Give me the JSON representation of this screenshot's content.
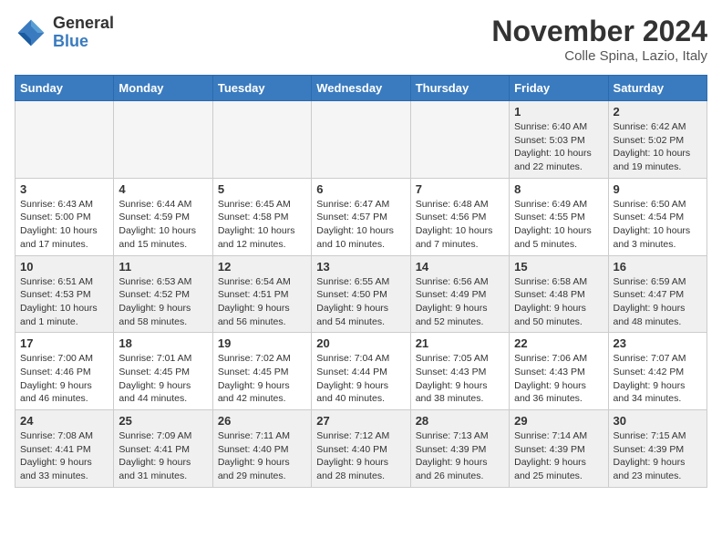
{
  "logo": {
    "general": "General",
    "blue": "Blue"
  },
  "title": "November 2024",
  "location": "Colle Spina, Lazio, Italy",
  "days_of_week": [
    "Sunday",
    "Monday",
    "Tuesday",
    "Wednesday",
    "Thursday",
    "Friday",
    "Saturday"
  ],
  "weeks": [
    [
      {
        "day": "",
        "info": ""
      },
      {
        "day": "",
        "info": ""
      },
      {
        "day": "",
        "info": ""
      },
      {
        "day": "",
        "info": ""
      },
      {
        "day": "",
        "info": ""
      },
      {
        "day": "1",
        "info": "Sunrise: 6:40 AM\nSunset: 5:03 PM\nDaylight: 10 hours\nand 22 minutes."
      },
      {
        "day": "2",
        "info": "Sunrise: 6:42 AM\nSunset: 5:02 PM\nDaylight: 10 hours\nand 19 minutes."
      }
    ],
    [
      {
        "day": "3",
        "info": "Sunrise: 6:43 AM\nSunset: 5:00 PM\nDaylight: 10 hours\nand 17 minutes."
      },
      {
        "day": "4",
        "info": "Sunrise: 6:44 AM\nSunset: 4:59 PM\nDaylight: 10 hours\nand 15 minutes."
      },
      {
        "day": "5",
        "info": "Sunrise: 6:45 AM\nSunset: 4:58 PM\nDaylight: 10 hours\nand 12 minutes."
      },
      {
        "day": "6",
        "info": "Sunrise: 6:47 AM\nSunset: 4:57 PM\nDaylight: 10 hours\nand 10 minutes."
      },
      {
        "day": "7",
        "info": "Sunrise: 6:48 AM\nSunset: 4:56 PM\nDaylight: 10 hours\nand 7 minutes."
      },
      {
        "day": "8",
        "info": "Sunrise: 6:49 AM\nSunset: 4:55 PM\nDaylight: 10 hours\nand 5 minutes."
      },
      {
        "day": "9",
        "info": "Sunrise: 6:50 AM\nSunset: 4:54 PM\nDaylight: 10 hours\nand 3 minutes."
      }
    ],
    [
      {
        "day": "10",
        "info": "Sunrise: 6:51 AM\nSunset: 4:53 PM\nDaylight: 10 hours\nand 1 minute."
      },
      {
        "day": "11",
        "info": "Sunrise: 6:53 AM\nSunset: 4:52 PM\nDaylight: 9 hours\nand 58 minutes."
      },
      {
        "day": "12",
        "info": "Sunrise: 6:54 AM\nSunset: 4:51 PM\nDaylight: 9 hours\nand 56 minutes."
      },
      {
        "day": "13",
        "info": "Sunrise: 6:55 AM\nSunset: 4:50 PM\nDaylight: 9 hours\nand 54 minutes."
      },
      {
        "day": "14",
        "info": "Sunrise: 6:56 AM\nSunset: 4:49 PM\nDaylight: 9 hours\nand 52 minutes."
      },
      {
        "day": "15",
        "info": "Sunrise: 6:58 AM\nSunset: 4:48 PM\nDaylight: 9 hours\nand 50 minutes."
      },
      {
        "day": "16",
        "info": "Sunrise: 6:59 AM\nSunset: 4:47 PM\nDaylight: 9 hours\nand 48 minutes."
      }
    ],
    [
      {
        "day": "17",
        "info": "Sunrise: 7:00 AM\nSunset: 4:46 PM\nDaylight: 9 hours\nand 46 minutes."
      },
      {
        "day": "18",
        "info": "Sunrise: 7:01 AM\nSunset: 4:45 PM\nDaylight: 9 hours\nand 44 minutes."
      },
      {
        "day": "19",
        "info": "Sunrise: 7:02 AM\nSunset: 4:45 PM\nDaylight: 9 hours\nand 42 minutes."
      },
      {
        "day": "20",
        "info": "Sunrise: 7:04 AM\nSunset: 4:44 PM\nDaylight: 9 hours\nand 40 minutes."
      },
      {
        "day": "21",
        "info": "Sunrise: 7:05 AM\nSunset: 4:43 PM\nDaylight: 9 hours\nand 38 minutes."
      },
      {
        "day": "22",
        "info": "Sunrise: 7:06 AM\nSunset: 4:43 PM\nDaylight: 9 hours\nand 36 minutes."
      },
      {
        "day": "23",
        "info": "Sunrise: 7:07 AM\nSunset: 4:42 PM\nDaylight: 9 hours\nand 34 minutes."
      }
    ],
    [
      {
        "day": "24",
        "info": "Sunrise: 7:08 AM\nSunset: 4:41 PM\nDaylight: 9 hours\nand 33 minutes."
      },
      {
        "day": "25",
        "info": "Sunrise: 7:09 AM\nSunset: 4:41 PM\nDaylight: 9 hours\nand 31 minutes."
      },
      {
        "day": "26",
        "info": "Sunrise: 7:11 AM\nSunset: 4:40 PM\nDaylight: 9 hours\nand 29 minutes."
      },
      {
        "day": "27",
        "info": "Sunrise: 7:12 AM\nSunset: 4:40 PM\nDaylight: 9 hours\nand 28 minutes."
      },
      {
        "day": "28",
        "info": "Sunrise: 7:13 AM\nSunset: 4:39 PM\nDaylight: 9 hours\nand 26 minutes."
      },
      {
        "day": "29",
        "info": "Sunrise: 7:14 AM\nSunset: 4:39 PM\nDaylight: 9 hours\nand 25 minutes."
      },
      {
        "day": "30",
        "info": "Sunrise: 7:15 AM\nSunset: 4:39 PM\nDaylight: 9 hours\nand 23 minutes."
      }
    ]
  ]
}
